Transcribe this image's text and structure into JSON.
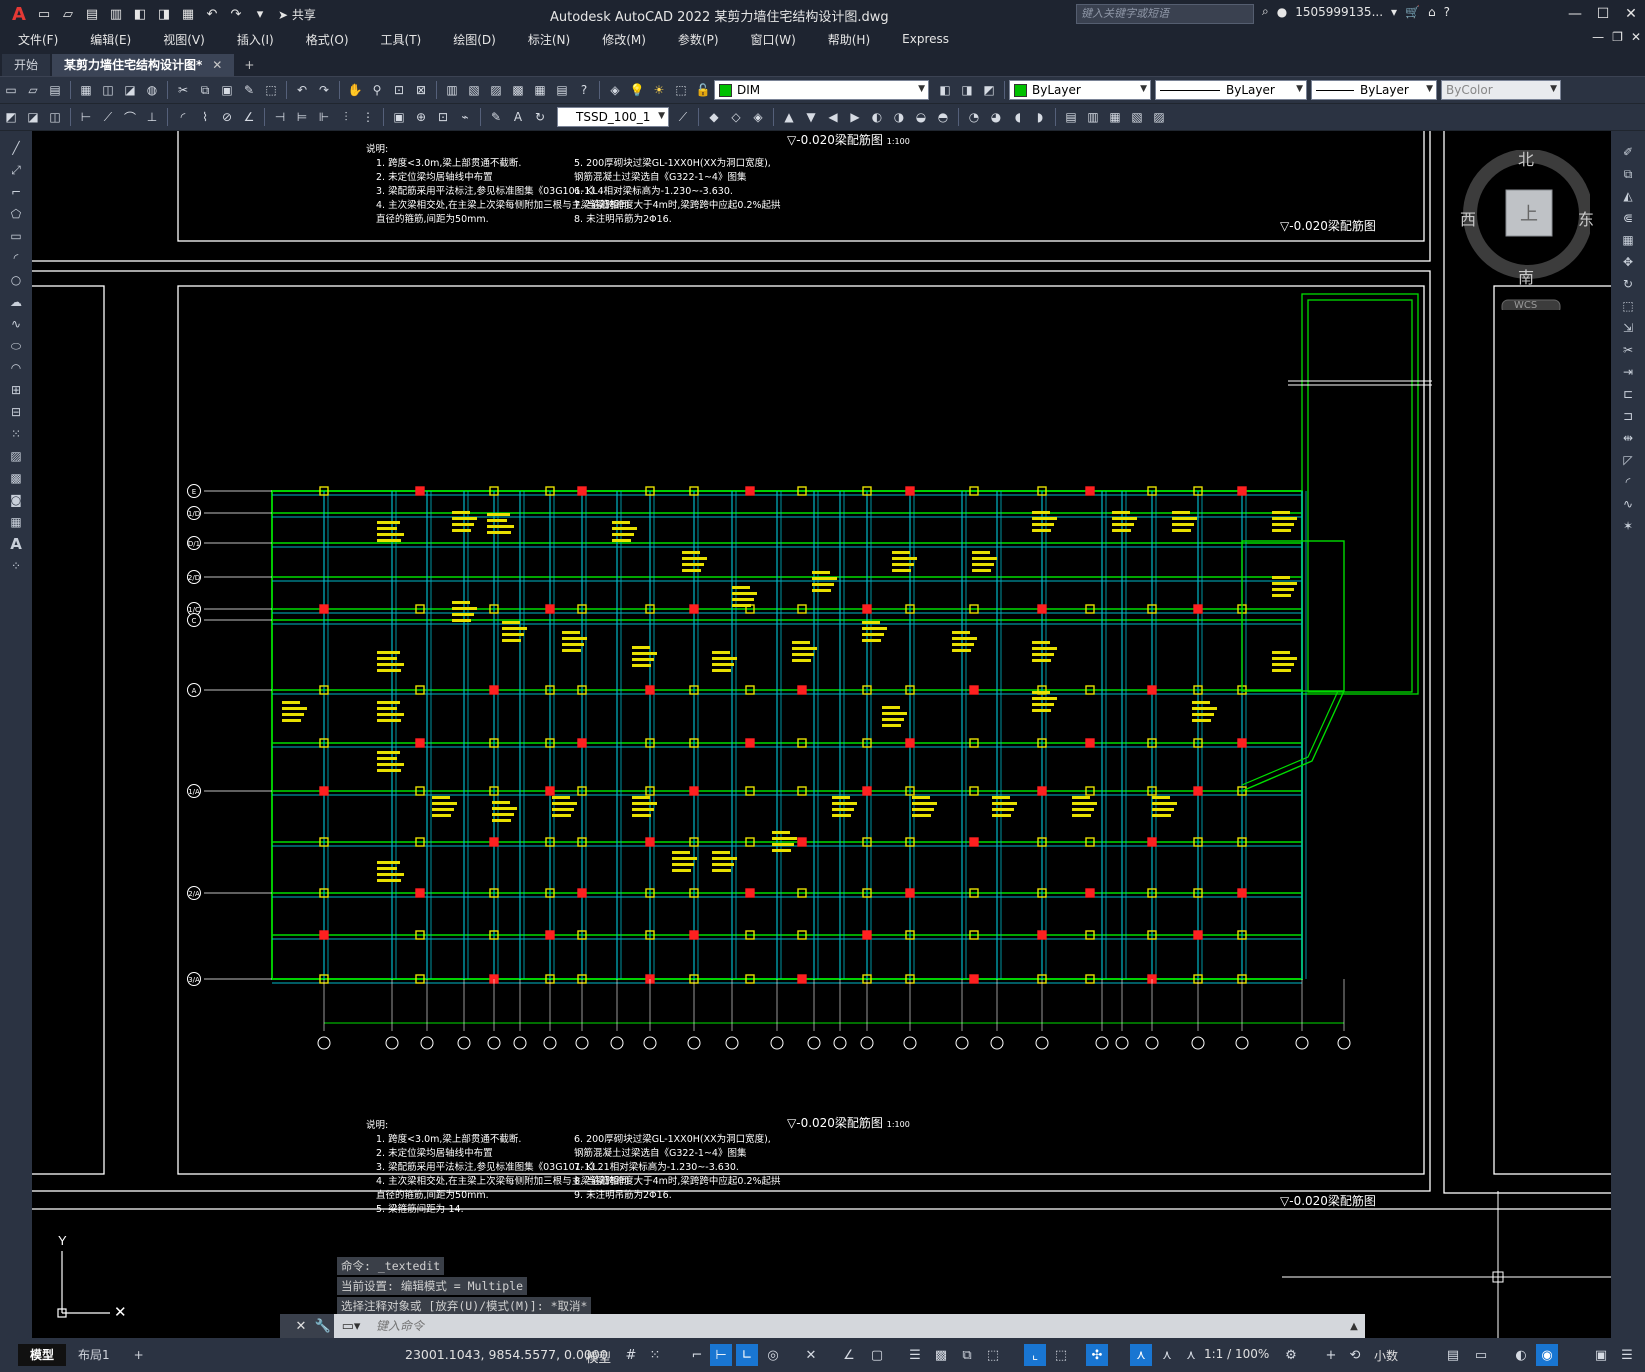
{
  "titlebar": {
    "app_logo": "A",
    "share_label": "共享",
    "title": "Autodesk AutoCAD 2022    某剪力墙住宅结构设计图.dwg",
    "search_placeholder": "键入关键字或短语",
    "user": "1505999135...",
    "help": "?"
  },
  "menu": {
    "items": [
      "文件(F)",
      "编辑(E)",
      "视图(V)",
      "插入(I)",
      "格式(O)",
      "工具(T)",
      "绘图(D)",
      "标注(N)",
      "修改(M)",
      "参数(P)",
      "窗口(W)",
      "帮助(H)",
      "Express"
    ]
  },
  "tabs": {
    "start": "开始",
    "active": "某剪力墙住宅结构设计图*",
    "close": "✕",
    "add": "+"
  },
  "toolbar": {
    "layer": "DIM",
    "layer_color": "#00c000",
    "color": "ByLayer",
    "linetype": "ByLayer",
    "lineweight": "ByLayer",
    "plotstyle": "ByColor",
    "textstyle": "TSSD_100_1"
  },
  "viewcube": {
    "north": "北",
    "south": "南",
    "east": "东",
    "west": "西",
    "top": "上",
    "wcs": "WCS"
  },
  "drawing": {
    "notes_top": {
      "heading": "说明:",
      "left": [
        "1. 跨度<3.0m,梁上部贯通不截断.",
        "2. 未定位梁均居轴线中布置",
        "3. 梁配筋采用平法标注,参见标准图集《03G101-1》.",
        "4. 主次梁相交处,在主梁上次梁每侧附加三根与主梁箍筋相同",
        "    直径的箍筋,间距为50mm."
      ],
      "right": [
        "5. 200厚砌块过梁GL-1XX0H(XX为洞口宽度),",
        "    钢筋混凝土过梁选自《G322-1~4》图集",
        "6. KL4相对梁标高为-1.230~-3.630.",
        "7. 当梁跨跨度大于4m时,梁跨跨中应起0.2%起拱",
        "8. 未注明吊筋为2Φ16."
      ]
    },
    "notes_bottom": {
      "heading": "说明:",
      "left": [
        "1. 跨度<3.0m,梁上部贯通不截断.",
        "2. 未定位梁均居轴线中布置",
        "3. 梁配筋采用平法标注,参见标准图集《03G101-1》.",
        "4. 主次梁相交处,在主梁上次梁每侧附加三根与主梁箍筋相同",
        "    直径的箍筋,间距为50mm.",
        "5. 梁箍筋间距为-14."
      ],
      "right": [
        "6. 200厚砌块过梁GL-1XX0H(XX为洞口宽度),",
        "    钢筋混凝土过梁选自《G322-1~4》图集",
        "7. KL21相对梁标高为-1.230~-3.630.",
        "8. 当梁跨跨度大于4m时,梁跨跨中应起0.2%起拱",
        "9. 未注明吊筋为2Φ16."
      ]
    },
    "title_top_center": "-0.020梁配筋图",
    "title_top_right": "-0.020梁配筋图",
    "title_bottom_center": "-0.020梁配筋图",
    "title_bottom_right": "-0.020梁配筋图",
    "scale_label": "1:100",
    "axis_row_labels": [
      "E",
      "1/D",
      "D/1",
      "2/D",
      "1/C",
      "C",
      "A",
      "1/A",
      "2/A",
      "3/A"
    ]
  },
  "command": {
    "history": [
      "命令: _textedit",
      "当前设置: 编辑模式 = Multiple",
      "选择注释对象或 [放弃(U)/模式(M)]: *取消*"
    ],
    "placeholder": "键入命令"
  },
  "statusbar": {
    "model_tab": "模型",
    "layout_tab": "布局1",
    "add_tab": "+",
    "coords": "23001.1043, 9854.5577, 0.0000",
    "space": "模型",
    "annotation_scale": "1:1 / 100%",
    "units": "小数"
  },
  "colors": {
    "ui_bg": "#2b3342",
    "titlebar_bg": "#1e2430",
    "canvas_bg": "#000000",
    "grid_green": "#00dd00",
    "beam_cyan": "#00b8c8",
    "column_yellow": "#e8e000",
    "column_red": "#ff2020",
    "accent_blue": "#1976d2"
  }
}
